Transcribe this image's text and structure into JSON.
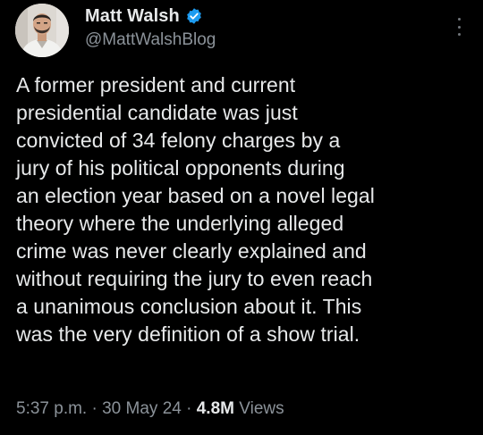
{
  "author": {
    "display_name": "Matt Walsh",
    "handle": "@MattWalshBlog",
    "verified": true,
    "verified_color": "#1d9bf0"
  },
  "tweet": {
    "text": "A former president and current\npresidential candidate was just\nconvicted of 34 felony charges by a\njury of his political opponents during\nan election year based on a novel legal\ntheory where the underlying alleged\ncrime was never clearly explained and\nwithout requiring the jury to even reach\na unanimous conclusion about it. This\nwas the very definition of a show trial."
  },
  "meta": {
    "time": "5:37 p.m.",
    "separator_1": " · ",
    "date": "30 May 24",
    "separator_2": " · ",
    "views_count": "4.8M",
    "views_label": " Views"
  },
  "icons": {
    "verified": "verified-badge-icon",
    "more": "more-options-icon"
  },
  "colors": {
    "background": "#000000",
    "text": "#e7e9ea",
    "muted": "#8b9299"
  }
}
